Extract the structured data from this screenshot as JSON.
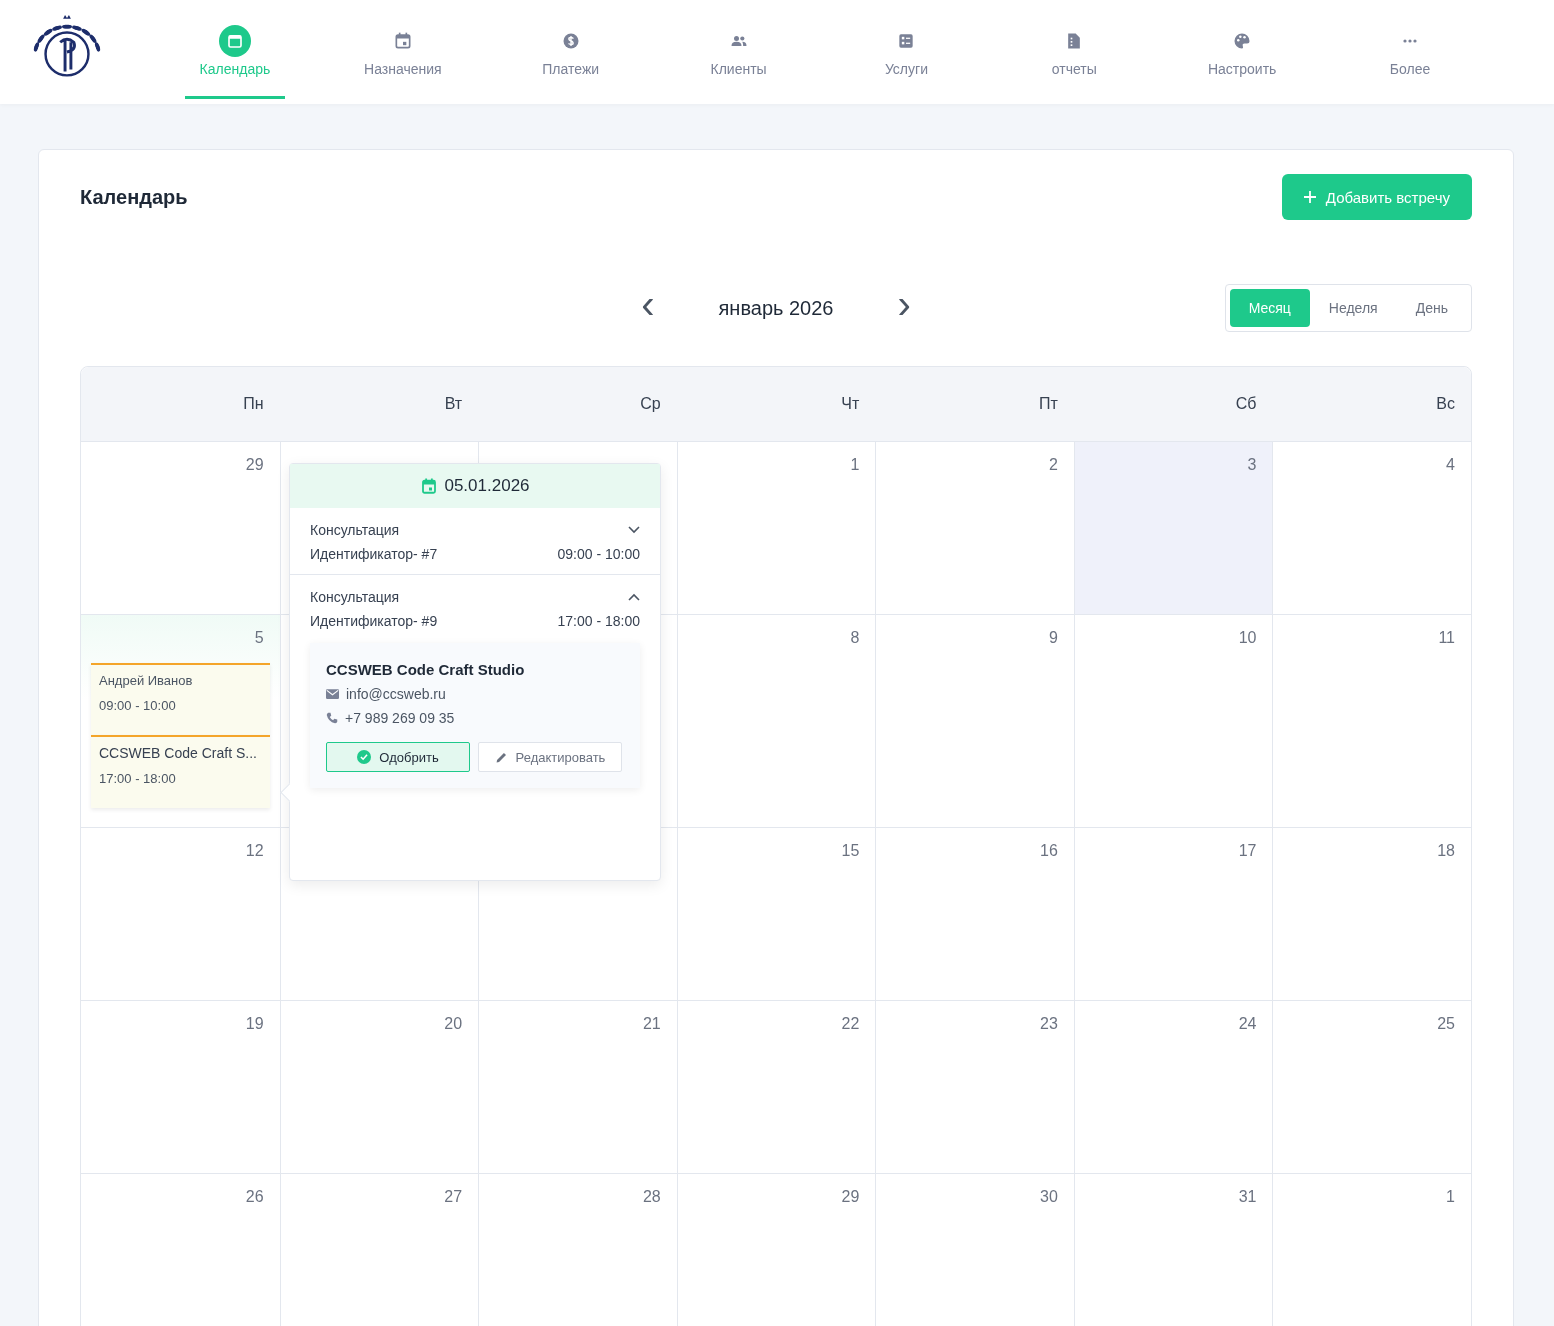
{
  "nav": {
    "items": [
      {
        "label": "Календарь",
        "selected": true
      },
      {
        "label": "Назначения",
        "selected": false
      },
      {
        "label": "Платежи",
        "selected": false
      },
      {
        "label": "Клиенты",
        "selected": false
      },
      {
        "label": "Услуги",
        "selected": false
      },
      {
        "label": "отчеты",
        "selected": false
      },
      {
        "label": "Настроить",
        "selected": false
      },
      {
        "label": "Более",
        "selected": false
      }
    ]
  },
  "page": {
    "title": "Календарь",
    "add_button": "Добавить встречу"
  },
  "calendar": {
    "month": "январь 2026",
    "prev": "‹",
    "next": "›",
    "views": [
      {
        "label": "Месяц",
        "selected": true
      },
      {
        "label": "Неделя",
        "selected": false
      },
      {
        "label": "День",
        "selected": false
      }
    ],
    "weekdays": [
      "Пн",
      "Вт",
      "Ср",
      "Чт",
      "Пт",
      "Сб",
      "Вс"
    ],
    "weeks": [
      [
        {
          "day": "29"
        },
        {
          "day": "1"
        },
        {
          "day": "2"
        },
        {
          "day": "3",
          "highlighted": true
        },
        {
          "day": "4"
        }
      ],
      [
        {
          "day": "5",
          "selected": true,
          "events": [
            {
              "title": "Андрей Иванов",
              "time": "09:00 - 10:00"
            },
            {
              "title": "CCSWEB Code Craft S...",
              "time": "17:00 - 18:00"
            }
          ]
        },
        {
          "day": "8"
        },
        {
          "day": "9"
        },
        {
          "day": "10"
        },
        {
          "day": "11"
        }
      ],
      [
        {
          "day": "12"
        },
        {
          "day": "15"
        },
        {
          "day": "16"
        },
        {
          "day": "17"
        },
        {
          "day": "18"
        }
      ],
      [
        {
          "day": "19"
        },
        {
          "day": "20"
        },
        {
          "day": "21"
        },
        {
          "day": "22"
        },
        {
          "day": "23"
        },
        {
          "day": "24"
        },
        {
          "day": "25"
        }
      ],
      [
        {
          "day": "26"
        },
        {
          "day": "27"
        },
        {
          "day": "28"
        },
        {
          "day": "29"
        },
        {
          "day": "30"
        },
        {
          "day": "31"
        },
        {
          "day": "1"
        }
      ]
    ]
  },
  "popup": {
    "date": "05.01.2026",
    "appointments": [
      {
        "service": "Консультация",
        "id": "Идентификатор- #7",
        "time": "09:00 - 10:00",
        "expanded": false
      },
      {
        "service": "Консультация",
        "id": "Идентификатор- #9",
        "time": "17:00 - 18:00",
        "expanded": true,
        "client": {
          "name": "CCSWEB Code Craft Studio",
          "email": "info@ccsweb.ru",
          "phone": "+7 989 269 09 35",
          "approve": "Одобрить",
          "edit": "Редактировать"
        }
      }
    ]
  }
}
